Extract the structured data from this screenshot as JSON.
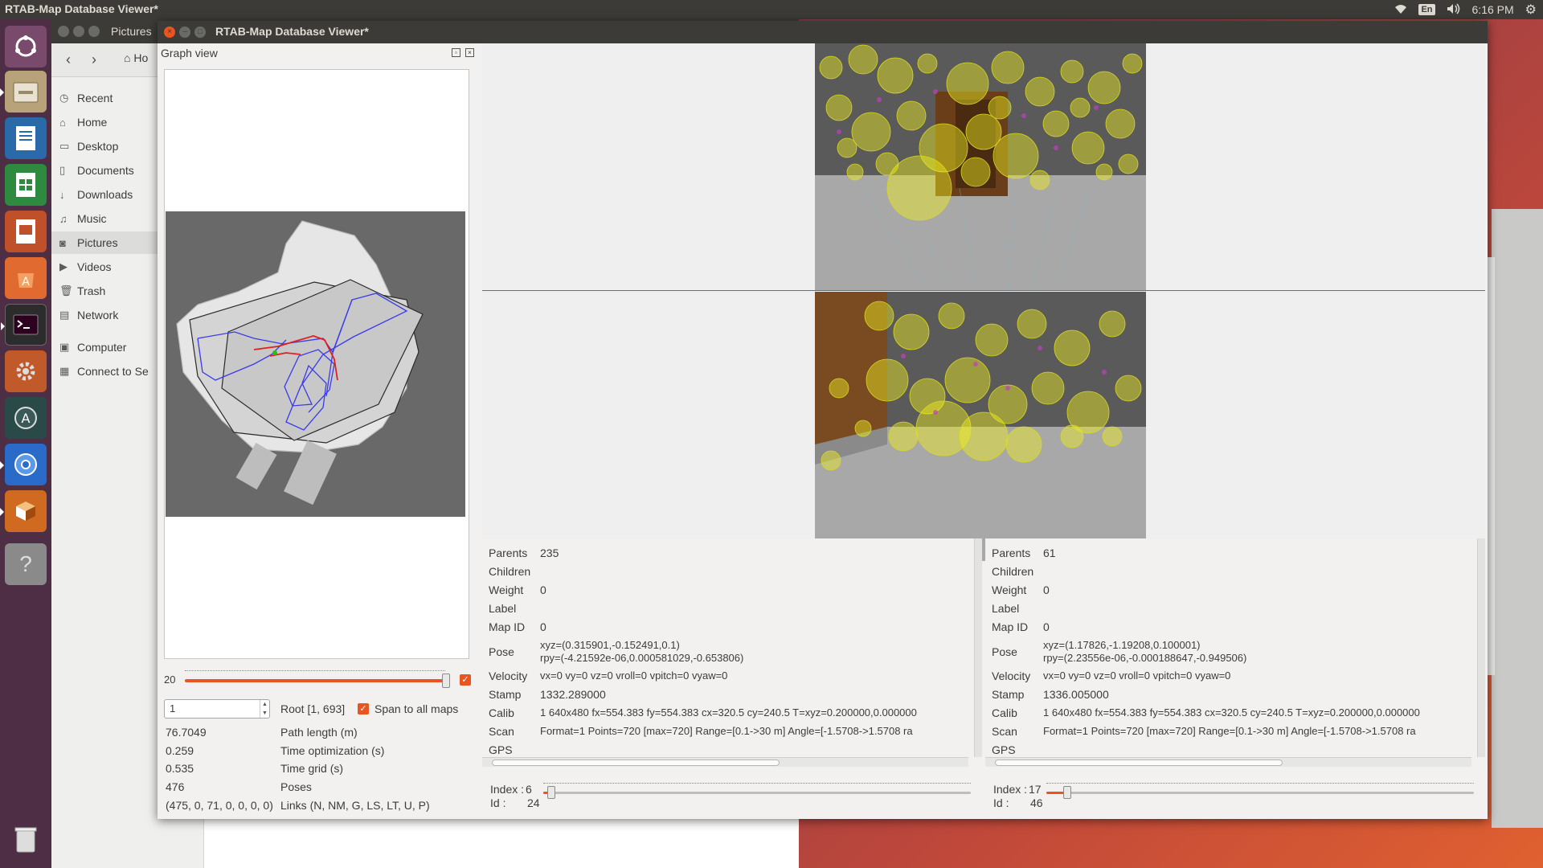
{
  "topbar": {
    "title": "RTAB-Map Database Viewer*",
    "lang": "En",
    "time": "6:16 PM"
  },
  "files": {
    "title": "Pictures",
    "crumb": "Ho",
    "sidebar": [
      {
        "label": "Recent",
        "icon": "clock-icon"
      },
      {
        "label": "Home",
        "icon": "home-icon"
      },
      {
        "label": "Desktop",
        "icon": "folder-icon"
      },
      {
        "label": "Documents",
        "icon": "document-icon"
      },
      {
        "label": "Downloads",
        "icon": "download-icon"
      },
      {
        "label": "Music",
        "icon": "music-icon"
      },
      {
        "label": "Pictures",
        "icon": "camera-icon"
      },
      {
        "label": "Videos",
        "icon": "video-icon"
      },
      {
        "label": "Trash",
        "icon": "trash-icon"
      },
      {
        "label": "Network",
        "icon": "network-icon"
      },
      {
        "label": "Computer",
        "icon": "computer-icon"
      },
      {
        "label": "Connect to Se",
        "icon": "server-icon"
      }
    ]
  },
  "window": {
    "title": "RTAB-Map Database Viewer*"
  },
  "graph_view": {
    "title": "Graph view",
    "slider_value": "20",
    "slider_level": 1.0,
    "root_input": "1",
    "root_label": "Root [1, 693]",
    "span_label": "Span to all maps",
    "stats": [
      {
        "value": "76.7049",
        "label": "Path length (m)"
      },
      {
        "value": "0.259",
        "label": "Time optimization (s)"
      },
      {
        "value": "0.535",
        "label": "Time grid (s)"
      },
      {
        "value": "476",
        "label": "Poses"
      },
      {
        "value": "(475, 0, 71, 0, 0, 0, 0)",
        "label": "Links (N, NM, G, LS, LT, U, P)"
      }
    ]
  },
  "left_node": {
    "rows": [
      {
        "key": "Parents",
        "value": "235"
      },
      {
        "key": "Children",
        "value": ""
      },
      {
        "key": "Weight",
        "value": "0"
      },
      {
        "key": "Label",
        "value": ""
      },
      {
        "key": "Map ID",
        "value": "0"
      },
      {
        "key": "Pose",
        "value": "xyz=(0.315901,-0.152491,0.1)",
        "value2": "rpy=(-4.21592e-06,0.000581029,-0.653806)"
      },
      {
        "key": "Velocity",
        "value": "vx=0 vy=0 vz=0 vroll=0 vpitch=0 vyaw=0"
      },
      {
        "key": "Stamp",
        "value": "1332.289000"
      },
      {
        "key": "Calib",
        "value": "1 640x480 fx=554.383 fy=554.383 cx=320.5 cy=240.5 T=xyz=0.200000,0.000000"
      },
      {
        "key": "Scan",
        "value": "Format=1 Points=720 [max=720] Range=[0.1->30 m] Angle=[-1.5708->1.5708 ra"
      },
      {
        "key": "GPS",
        "value": ""
      }
    ],
    "index_label": "Index :",
    "index": "6",
    "id_label": "Id :",
    "id": "24",
    "slider_level": 0.01
  },
  "right_node": {
    "rows": [
      {
        "key": "Parents",
        "value": "61"
      },
      {
        "key": "Children",
        "value": ""
      },
      {
        "key": "Weight",
        "value": "0"
      },
      {
        "key": "Label",
        "value": ""
      },
      {
        "key": "Map ID",
        "value": "0"
      },
      {
        "key": "Pose",
        "value": "xyz=(1.17826,-1.19208,0.100001)",
        "value2": "rpy=(2.23556e-06,-0.000188647,-0.949506)"
      },
      {
        "key": "Velocity",
        "value": "vx=0 vy=0 vz=0 vroll=0 vpitch=0 vyaw=0"
      },
      {
        "key": "Stamp",
        "value": "1336.005000"
      },
      {
        "key": "Calib",
        "value": "1 640x480 fx=554.383 fy=554.383 cx=320.5 cy=240.5 T=xyz=0.200000,0.000000"
      },
      {
        "key": "Scan",
        "value": "Format=1 Points=720 [max=720] Range=[0.1->30 m] Angle=[-1.5708->1.5708 ra"
      },
      {
        "key": "GPS",
        "value": ""
      }
    ],
    "index_label": "Index :",
    "index": "17",
    "id_label": "Id :",
    "id": "46",
    "slider_level": 0.04
  },
  "colors": {
    "accent": "#e95420",
    "titlebar": "#3c3b37",
    "launcher": "#4d2e45",
    "feature": "#f0f020"
  }
}
